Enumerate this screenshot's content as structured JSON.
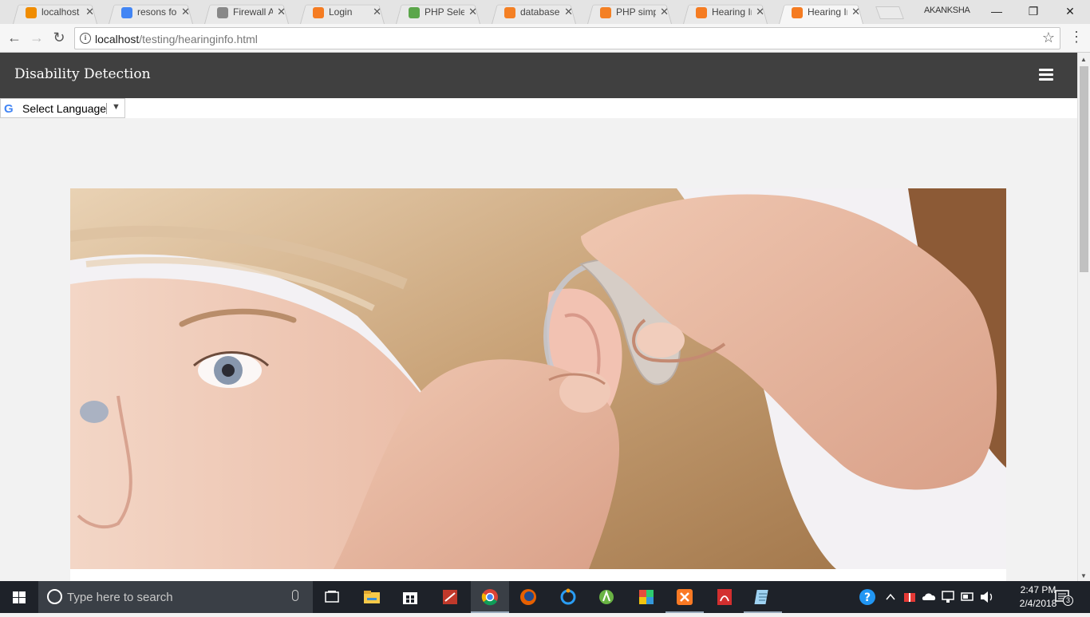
{
  "browser": {
    "tabs": [
      {
        "title": "localhost /",
        "favicon": "phpmyadmin-icon",
        "color": "#f08c00",
        "active": false
      },
      {
        "title": "resons for l",
        "favicon": "google-icon",
        "color": "#4285f4",
        "active": false
      },
      {
        "title": "Firewall Aut",
        "favicon": "page-icon",
        "color": "#888888",
        "active": false
      },
      {
        "title": "Login",
        "favicon": "xampp-icon",
        "color": "#f57c22",
        "active": false
      },
      {
        "title": "PHP Select",
        "favicon": "w3schools-icon",
        "color": "#5ba64a",
        "active": false
      },
      {
        "title": "database -",
        "favicon": "stackoverflow-icon",
        "color": "#f48024",
        "active": false
      },
      {
        "title": "PHP simple",
        "favicon": "stackoverflow-icon",
        "color": "#f48024",
        "active": false
      },
      {
        "title": "Hearing Im",
        "favicon": "xampp-icon",
        "color": "#f57c22",
        "active": false
      },
      {
        "title": "Hearing Im",
        "favicon": "xampp-icon",
        "color": "#f57c22",
        "active": true
      }
    ],
    "profile_name": "AKANKSHA",
    "url_host": "localhost",
    "url_path": "/testing/hearinginfo.html"
  },
  "page": {
    "brand": "Disability Detection",
    "language_select_label": "Select Language",
    "hero_image": "hearing-aid-photo"
  },
  "taskbar": {
    "search_placeholder": "Type here to search",
    "apps": [
      "task-view",
      "file-explorer",
      "store",
      "app-red",
      "chrome",
      "firefox",
      "app-blue-ring",
      "android-studio",
      "app-colorful",
      "xampp",
      "acrobat",
      "app-notepad"
    ],
    "time": "2:47 PM",
    "date": "2/4/2018",
    "notification_count": "3"
  }
}
